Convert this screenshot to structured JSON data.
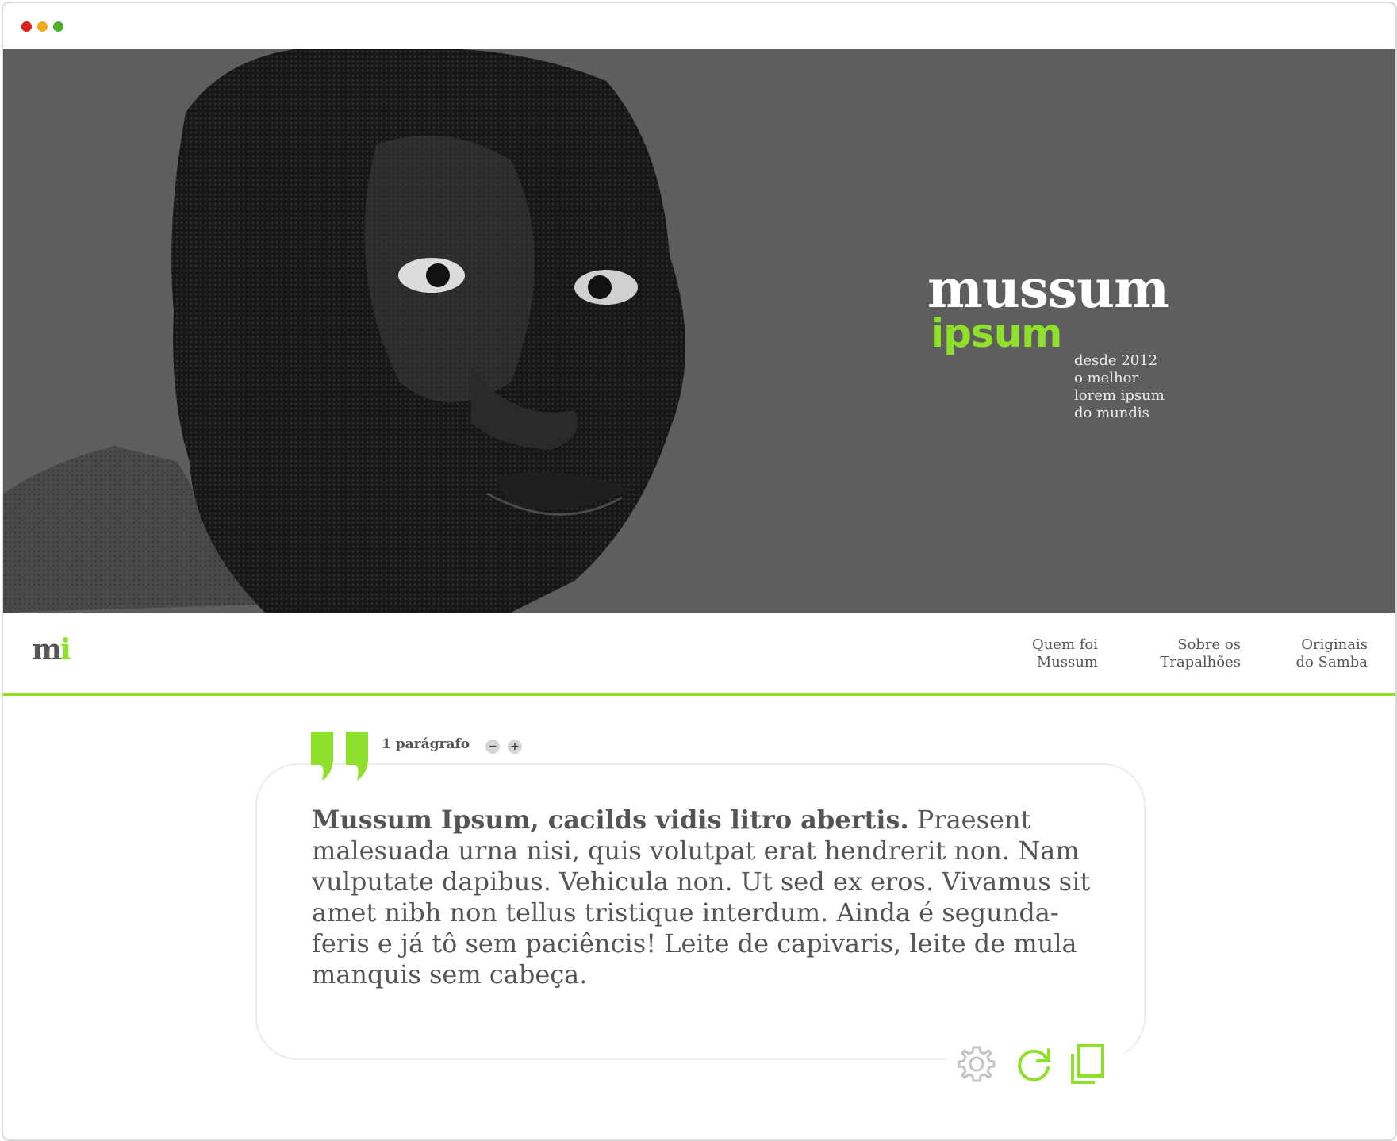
{
  "window": {
    "controls": [
      "close",
      "minimize",
      "maximize"
    ]
  },
  "hero": {
    "brand_line1": "mussum",
    "brand_line2": "ipsum",
    "tagline": [
      "desde 2012",
      "o melhor",
      "lorem ipsum",
      "do mundis"
    ],
    "colors": {
      "background": "#5e5e5e",
      "accent": "#8fe02a"
    }
  },
  "nav": {
    "logo_main": "m",
    "logo_accent": "i",
    "items": [
      {
        "line1": "Quem foi",
        "line2": "Mussum"
      },
      {
        "line1": "Sobre os",
        "line2": "Trapalhões"
      },
      {
        "line1": "Originais",
        "line2": "do Samba"
      }
    ]
  },
  "generator": {
    "paragraph_count_label": "1 parágrafo",
    "decrease_label": "−",
    "increase_label": "+",
    "text_bold": "Mussum Ipsum, cacilds vidis litro abertis.",
    "text_body": " Praesent malesuada urna nisi, quis volutpat erat hendrerit non. Nam vulputate dapibus. Vehicula non. Ut sed ex eros. Vivamus sit amet nibh non tellus tristique interdum. Ainda é segunda-feris e já tô sem paciêncis! Leite de capivaris, leite de mula manquis sem cabeça.",
    "tools": [
      "gear-icon",
      "refresh-icon",
      "copy-icon"
    ]
  }
}
